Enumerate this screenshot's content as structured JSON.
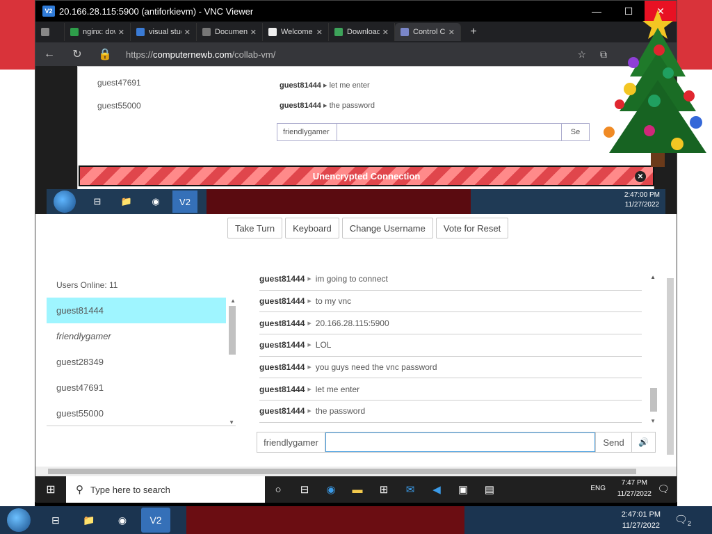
{
  "vnc_window": {
    "title": "20.166.28.115:5900 (antiforkievm) - VNC Viewer",
    "logo": "V2",
    "minimize": "—",
    "maximize": "☐",
    "close": "✕"
  },
  "browser": {
    "tabs": [
      {
        "label": "nginx: dowr",
        "icon": "nginx-icon"
      },
      {
        "label": "visual studic",
        "icon": "search-icon"
      },
      {
        "label": "Documenta",
        "icon": "page-icon"
      },
      {
        "label": "Welcome tc",
        "icon": "page-icon"
      },
      {
        "label": "Download T",
        "icon": "download-icon"
      },
      {
        "label": "Control Cc",
        "icon": "control-icon"
      }
    ],
    "url_prefix": "https://",
    "url_domain": "computernewb.com",
    "url_path": "/collab-vm/"
  },
  "nested_page": {
    "users": [
      "guest47691",
      "guest55000"
    ],
    "messages": [
      {
        "user": "guest81444",
        "text": "let me enter"
      },
      {
        "user": "guest81444",
        "text": "the password"
      }
    ],
    "username": "friendlygamer",
    "send": "Se"
  },
  "banner": {
    "text": "Unencrypted Connection",
    "close": "✕"
  },
  "remote_taskbar": {
    "time": "2:47:00 PM",
    "date": "11/27/2022"
  },
  "toolbar": {
    "take_turn": "Take Turn",
    "keyboard": "Keyboard",
    "change_username": "Change Username",
    "vote_reset": "Vote for Reset"
  },
  "users_online": "Users Online: 11",
  "users": [
    {
      "name": "guest81444",
      "selected": true
    },
    {
      "name": "friendlygamer",
      "italic": true
    },
    {
      "name": "guest28349"
    },
    {
      "name": "guest47691"
    },
    {
      "name": "guest55000"
    }
  ],
  "messages": [
    {
      "user": "guest81444",
      "text": "im going to connect"
    },
    {
      "user": "guest81444",
      "text": "to my vnc"
    },
    {
      "user": "guest81444",
      "text": "20.166.28.115:5900"
    },
    {
      "user": "guest81444",
      "text": "LOL"
    },
    {
      "user": "guest81444",
      "text": "you guys need the vnc password"
    },
    {
      "user": "guest81444",
      "text": "let me enter"
    },
    {
      "user": "guest81444",
      "text": "the password"
    }
  ],
  "chat_input": {
    "username": "friendlygamer",
    "value": "",
    "send": "Send"
  },
  "win10_taskbar": {
    "search_placeholder": "Type here to search",
    "lang": "ENG",
    "time": "7:47 PM",
    "date": "11/27/2022"
  },
  "host_taskbar": {
    "time": "2:47:01 PM",
    "date": "11/27/2022",
    "notifications": "2"
  }
}
